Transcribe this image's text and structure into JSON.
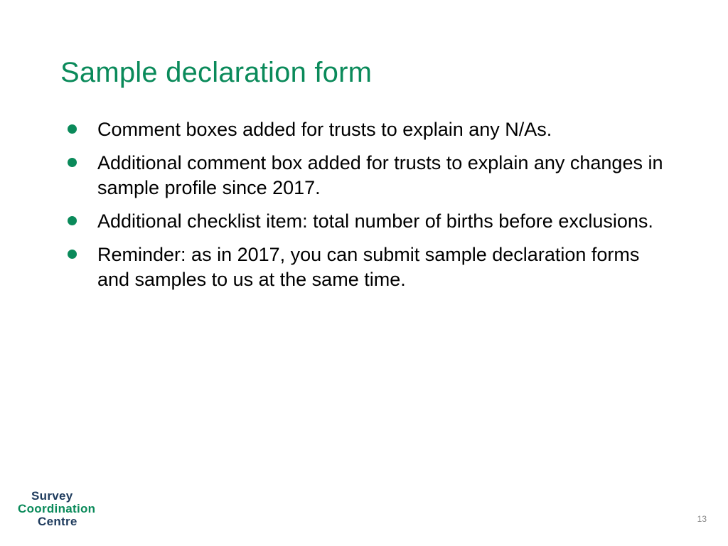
{
  "title": "Sample declaration form",
  "bullets": [
    "Comment boxes added for trusts to explain any N/As.",
    "Additional comment box added for trusts to explain any changes in sample profile since 2017.",
    "Additional checklist item: total number of births before exclusions.",
    "Reminder: as in 2017, you can submit sample declaration forms and samples to us at the same time."
  ],
  "logo": {
    "line1": "Survey",
    "line2": "Coordination",
    "line3": "Centre"
  },
  "page_number": "13"
}
